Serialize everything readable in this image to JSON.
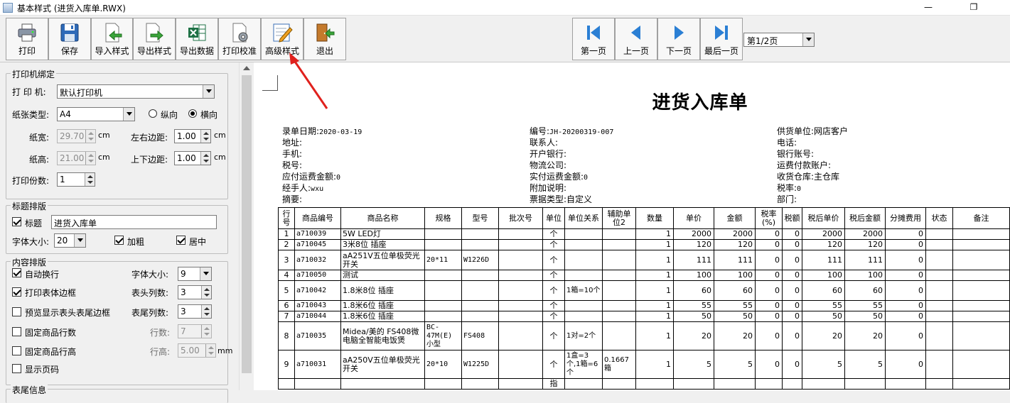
{
  "window": {
    "title": "基本样式 (进货入库单.RWX)",
    "minimize": "—",
    "restore": "❐"
  },
  "toolbar": {
    "buttons": [
      {
        "label": "打印",
        "icon": "printer-icon"
      },
      {
        "label": "保存",
        "icon": "floppy-disk-icon"
      },
      {
        "label": "导入样式",
        "icon": "import-style-icon"
      },
      {
        "label": "导出样式",
        "icon": "export-style-icon"
      },
      {
        "label": "导出数据",
        "icon": "excel-export-icon"
      },
      {
        "label": "打印校准",
        "icon": "print-calibrate-icon"
      },
      {
        "label": "高级样式",
        "icon": "edit-style-icon"
      },
      {
        "label": "退出",
        "icon": "exit-door-icon"
      }
    ],
    "nav": [
      {
        "label": "第一页",
        "icon": "first-page-icon"
      },
      {
        "label": "上一页",
        "icon": "prev-page-icon"
      },
      {
        "label": "下一页",
        "icon": "next-page-icon"
      },
      {
        "label": "最后一页",
        "icon": "last-page-icon"
      }
    ],
    "page_select": "第1/2页"
  },
  "panel": {
    "printer_group": {
      "title": "打印机绑定",
      "printer_label": "打 印 机:",
      "printer_value": "默认打印机",
      "paper_label": "纸张类型:",
      "paper_value": "A4",
      "portrait": "纵向",
      "landscape": "横向",
      "width_label": "纸宽:",
      "width_value": "29.70",
      "height_label": "纸高:",
      "height_value": "21.00",
      "unit_cm": "cm",
      "lr_margin_label": "左右边距:",
      "lr_margin_value": "1.00",
      "tb_margin_label": "上下边距:",
      "tb_margin_value": "1.00",
      "copies_label": "打印份数:",
      "copies_value": "1"
    },
    "title_group": {
      "title": "标题排版",
      "title_check_label": "标题",
      "title_value": "进货入库单",
      "font_size_label": "字体大小:",
      "font_size_value": "20",
      "bold_label": "加粗",
      "center_label": "居中"
    },
    "content_group": {
      "title": "内容排版",
      "auto_wrap": "自动换行",
      "font_size_label": "字体大小:",
      "font_size_value": "9",
      "print_border": "打印表体边框",
      "header_cols_label": "表头列数:",
      "header_cols_value": "3",
      "preview_border": "预览显示表头表尾边框",
      "footer_cols_label": "表尾列数:",
      "footer_cols_value": "3",
      "fixed_rows": "固定商品行数",
      "rows_label": "行数:",
      "rows_value": "7",
      "fixed_height": "固定商品行高",
      "row_height_label": "行高:",
      "row_height_value": "5.00",
      "unit_mm": "mm",
      "show_page_no": "显示页码",
      "next_section": "表尾信息"
    }
  },
  "document": {
    "title": "进货入库单",
    "info_col1": [
      {
        "k": "录单日期:",
        "v": "2020-03-19"
      },
      {
        "k": "地址:",
        "v": ""
      },
      {
        "k": "手机:",
        "v": ""
      },
      {
        "k": "税号:",
        "v": ""
      },
      {
        "k": "应付运费金额:",
        "v": "0"
      },
      {
        "k": "经手人:",
        "v": "wxu"
      },
      {
        "k": "摘要:",
        "v": ""
      }
    ],
    "info_col2": [
      {
        "k": "编号:",
        "v": "JH-20200319-007"
      },
      {
        "k": "联系人:",
        "v": ""
      },
      {
        "k": "开户银行:",
        "v": ""
      },
      {
        "k": "物流公司:",
        "v": ""
      },
      {
        "k": "实付运费金额:",
        "v": "0"
      },
      {
        "k": "附加说明:",
        "v": ""
      },
      {
        "k": "票据类型:",
        "v": "自定义"
      }
    ],
    "info_col3": [
      {
        "k": "供货单位:",
        "v": "网店客户"
      },
      {
        "k": "电话:",
        "v": ""
      },
      {
        "k": "银行账号:",
        "v": ""
      },
      {
        "k": "运费付款账户:",
        "v": ""
      },
      {
        "k": "收货仓库:",
        "v": "主仓库"
      },
      {
        "k": "税率:",
        "v": "0"
      },
      {
        "k": "部门:",
        "v": ""
      }
    ],
    "columns": [
      "行号",
      "商品编号",
      "商品名称",
      "规格",
      "型号",
      "批次号",
      "单位",
      "单位关系",
      "辅助单位2",
      "数量",
      "单价",
      "金额",
      "税率(%)",
      "税额",
      "税后单价",
      "税后金额",
      "分摊费用",
      "状态",
      "备注"
    ],
    "rows": [
      [
        "1",
        "a710039",
        "5W LED灯",
        "",
        "",
        "",
        "个",
        "",
        "",
        "1",
        "2000",
        "2000",
        "0",
        "0",
        "2000",
        "2000",
        "0",
        "",
        ""
      ],
      [
        "2",
        "a710045",
        "3米8位 插座",
        "",
        "",
        "",
        "个",
        "",
        "",
        "1",
        "120",
        "120",
        "0",
        "0",
        "120",
        "120",
        "0",
        "",
        ""
      ],
      [
        "3",
        "a710032",
        "aA251V五位单极荧光开关",
        "20*11",
        "W1226D",
        "",
        "个",
        "",
        "",
        "1",
        "111",
        "111",
        "0",
        "0",
        "111",
        "111",
        "0",
        "",
        ""
      ],
      [
        "4",
        "a710050",
        "测试",
        "",
        "",
        "",
        "个",
        "",
        "",
        "1",
        "100",
        "100",
        "0",
        "0",
        "100",
        "100",
        "0",
        "",
        ""
      ],
      [
        "5",
        "a710042",
        "1.8米8位 插座",
        "",
        "",
        "",
        "个",
        "1箱=10个",
        "",
        "1",
        "60",
        "60",
        "0",
        "0",
        "60",
        "60",
        "0",
        "",
        ""
      ],
      [
        "6",
        "a710043",
        "1.8米6位 插座",
        "",
        "",
        "",
        "个",
        "",
        "",
        "1",
        "55",
        "55",
        "0",
        "0",
        "55",
        "55",
        "0",
        "",
        ""
      ],
      [
        "7",
        "a710044",
        "1.8米6位 插座",
        "",
        "",
        "",
        "个",
        "",
        "",
        "1",
        "50",
        "50",
        "0",
        "0",
        "50",
        "50",
        "0",
        "",
        ""
      ],
      [
        "8",
        "a710035",
        "Midea/美的 FS408微电脑全智能电饭煲",
        "BC-47M(E) 小型",
        "FS408",
        "",
        "个",
        "1对=2个",
        "",
        "1",
        "20",
        "20",
        "0",
        "0",
        "20",
        "20",
        "0",
        "",
        ""
      ],
      [
        "9",
        "a710031",
        "aA250V五位单极荧光开关",
        "20*10",
        "W1225D",
        "",
        "个",
        "1盒=3个,1箱=6个",
        "0.1667箱",
        "1",
        "5",
        "5",
        "0",
        "0",
        "5",
        "5",
        "0",
        "",
        ""
      ],
      [
        "",
        "",
        "",
        "",
        "",
        "",
        "指",
        "",
        "",
        "",
        "",
        "",
        "",
        "",
        "",
        "",
        "",
        "",
        ""
      ]
    ]
  }
}
